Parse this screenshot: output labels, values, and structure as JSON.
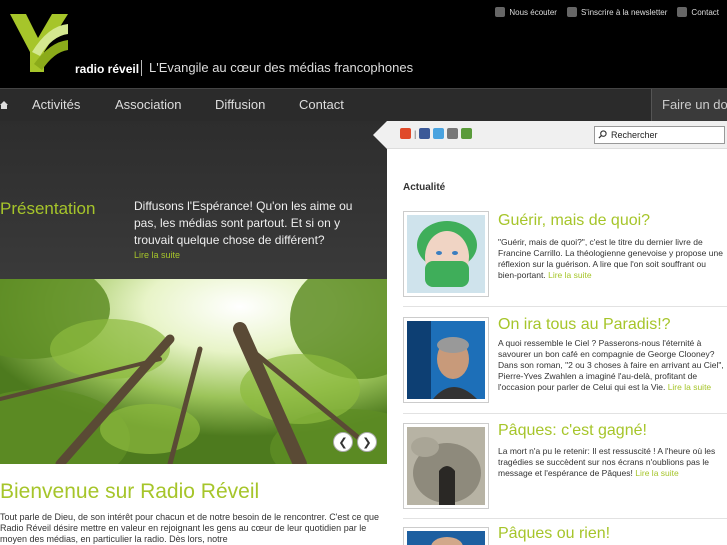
{
  "header": {
    "brand": "radio réveil",
    "tagline": "L'Evangile au cœur des médias francophones",
    "links": [
      "Nous écouter",
      "S'inscrire à la newsletter",
      "Contact"
    ]
  },
  "nav": {
    "items": [
      "Activités",
      "Association",
      "Diffusion",
      "Contact"
    ],
    "donate_label": "Faire un do"
  },
  "presentation": {
    "title": "Présentation",
    "text": "Diffusons l'Espérance! Qu'on les aime ou pas, les médias sont partout. Et si on y trouvait quelque chose de différent?",
    "more": "Lire la suite"
  },
  "welcome": {
    "title": "Bienvenue sur Radio Réveil",
    "text": "Tout parle de Dieu, de son intérêt pour chacun et de notre besoin de le rencontrer. C'est ce que Radio Réveil désire mettre en valeur en rejoignant les gens au cœur de leur quotidien par le moyen des médias, en particulier la radio. Dès lors, notre"
  },
  "sidebar": {
    "search_label": "Rechercher",
    "section_title": "Actualité",
    "more_label": "Lire la suite",
    "news": [
      {
        "title": "Guérir, mais de quoi?",
        "text": "\"Guérir, mais de quoi?\", c'est le titre du dernier livre de Francine Carrillo. La théologienne genevoise y propose une réflexion sur la guérison. A lire que l'on soit souffrant ou bien-portant."
      },
      {
        "title": "On ira tous au Paradis!?",
        "text": "A quoi ressemble le Ciel ? Passerons-nous l'éternité à savourer un bon café en compagnie de George Clooney? Dans son roman, \"2 ou 3 choses à faire en arrivant au Ciel\", Pierre-Yves Zwahlen a imaginé l'au-delà, profitant de l'occasion pour parler de Celui qui est la Vie."
      },
      {
        "title": "Pâques: c'est gagné!",
        "text": "La mort n'a pu le retenir: Il est ressuscité ! A l'heure où les tragédies se succèdent sur nos écrans n'oublions pas le message et l'espérance de Pâques!"
      },
      {
        "title": "Pâques ou rien!",
        "text": ""
      }
    ]
  },
  "colors": {
    "accent": "#a6c52a",
    "header_bg": "#000000",
    "nav_bg": "#2b2b2b"
  }
}
